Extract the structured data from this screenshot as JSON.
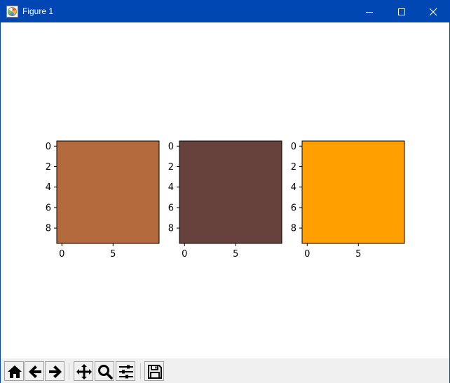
{
  "window": {
    "title": "Figure 1",
    "icons": {
      "app": "matplotlib-figure-icon",
      "minimize": "minimize-icon",
      "maximize": "maximize-icon",
      "close": "close-icon"
    }
  },
  "chart_data": [
    {
      "type": "heatmap",
      "color": "#b36b3d",
      "xlim": [
        -0.5,
        9.5
      ],
      "ylim": [
        9.5,
        -0.5
      ],
      "xticks": [
        "0",
        "5"
      ],
      "yticks": [
        "0",
        "2",
        "4",
        "6",
        "8"
      ]
    },
    {
      "type": "heatmap",
      "color": "#67423c",
      "xlim": [
        -0.5,
        9.5
      ],
      "ylim": [
        9.5,
        -0.5
      ],
      "xticks": [
        "0",
        "5"
      ],
      "yticks": [
        "0",
        "2",
        "4",
        "6",
        "8"
      ]
    },
    {
      "type": "heatmap",
      "color": "#ff9f00",
      "xlim": [
        -0.5,
        9.5
      ],
      "ylim": [
        9.5,
        -0.5
      ],
      "xticks": [
        "0",
        "5"
      ],
      "yticks": [
        "0",
        "2",
        "4",
        "6",
        "8"
      ]
    }
  ],
  "toolbar": {
    "buttons": [
      {
        "name": "home",
        "icon": "home-icon"
      },
      {
        "name": "back",
        "icon": "arrow-left-icon"
      },
      {
        "name": "forward",
        "icon": "arrow-right-icon"
      },
      {
        "name": "pan",
        "icon": "move-icon"
      },
      {
        "name": "zoom",
        "icon": "magnifier-icon"
      },
      {
        "name": "configure-subplots",
        "icon": "sliders-icon"
      },
      {
        "name": "save",
        "icon": "floppy-disk-icon"
      }
    ]
  }
}
